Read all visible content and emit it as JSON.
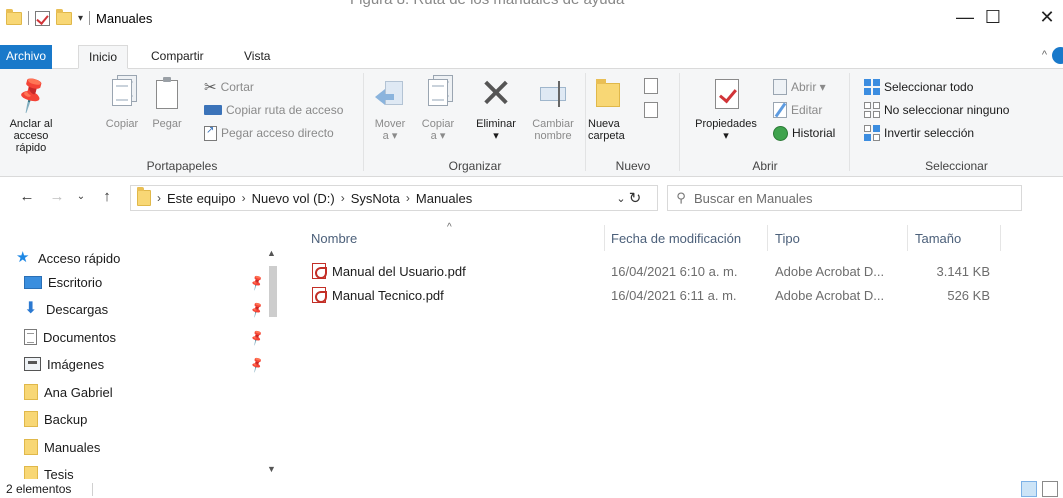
{
  "cut_caption": "Figura 8. Ruta de los manuales de ayuda",
  "window": {
    "title": "Manuales",
    "minimize": "—",
    "maximize": "☐",
    "close": "✕"
  },
  "tabs": {
    "file": "Archivo",
    "home": "Inicio",
    "share": "Compartir",
    "view": "Vista"
  },
  "ribbon": {
    "clipboard": {
      "pin_l1": "Anclar al",
      "pin_l2": "acceso rápido",
      "copy": "Copiar",
      "paste": "Pegar",
      "cut": "Cortar",
      "copy_path": "Copiar ruta de acceso",
      "paste_shortcut": "Pegar acceso directo",
      "label": "Portapapeles"
    },
    "organize": {
      "move_l1": "Mover",
      "move_l2": "a ▾",
      "copy_l1": "Copiar",
      "copy_l2": "a ▾",
      "delete_l1": "Eliminar",
      "delete_l2": "▾",
      "rename_l1": "Cambiar",
      "rename_l2": "nombre",
      "label": "Organizar"
    },
    "new": {
      "folder_l1": "Nueva",
      "folder_l2": "carpeta",
      "label": "Nuevo"
    },
    "open": {
      "properties_l1": "Propiedades",
      "properties_l2": "▾",
      "open": "Abrir ▾",
      "edit": "Editar",
      "history": "Historial",
      "label": "Abrir"
    },
    "select": {
      "select_all": "Seleccionar todo",
      "select_none": "No seleccionar ninguno",
      "invert": "Invertir selección",
      "label": "Seleccionar"
    }
  },
  "address": {
    "crumbs": [
      "Este equipo",
      "Nuevo vol (D:)",
      "SysNota",
      "Manuales"
    ],
    "search_placeholder": "Buscar en Manuales"
  },
  "nav_pane": {
    "quick_access": "Acceso rápido",
    "items": [
      "Escritorio",
      "Descargas",
      "Documentos",
      "Imágenes",
      "Ana Gabriel",
      "Backup",
      "Manuales",
      "Tesis"
    ]
  },
  "columns": {
    "name": "Nombre",
    "modified": "Fecha de modificación",
    "type": "Tipo",
    "size": "Tamaño"
  },
  "files": [
    {
      "name": "Manual del Usuario.pdf",
      "modified": "16/04/2021 6:10 a. m.",
      "type": "Adobe Acrobat D...",
      "size": "3.141 KB"
    },
    {
      "name": "Manual Tecnico.pdf",
      "modified": "16/04/2021 6:11 a. m.",
      "type": "Adobe Acrobat D...",
      "size": "526 KB"
    }
  ],
  "status": {
    "count": "2 elementos"
  },
  "icons": {
    "folder": "folder-icon",
    "pdf": "pdf-icon",
    "pin": "pin-icon",
    "star": "star-icon"
  },
  "colors": {
    "file_tab": "#1979ca",
    "ribbon_bg": "#f5f6f7",
    "folder": "#f8d775",
    "pdf": "#c32f27"
  }
}
